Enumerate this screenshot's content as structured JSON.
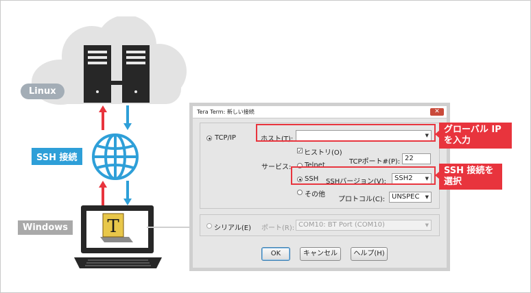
{
  "labels": {
    "linux": "Linux",
    "ssh_connection": "SSH 接続",
    "windows": "Windows",
    "callout_ip_line1": "グローバル IP",
    "callout_ip_line2": "を入力",
    "callout_ssh_line1": "SSH 接続を",
    "callout_ssh_line2": "選択"
  },
  "dialog": {
    "title": "Tera Term: 新しい接続",
    "close": "✕",
    "tcpip": "TCP/IP",
    "host_label": "ホスト(T):",
    "host_value": "",
    "history": "ヒストリ(O)",
    "service_label": "サービス:",
    "telnet": "Telnet",
    "tcp_port_label": "TCPポート#(P):",
    "tcp_port_value": "22",
    "ssh": "SSH",
    "ssh_version_label": "SSHバージョン(V):",
    "ssh_version_value": "SSH2",
    "other": "その他",
    "protocol_label": "プロトコル(C):",
    "protocol_value": "UNSPEC",
    "serial": "シリアル(E)",
    "port_label": "ポート(R):",
    "port_value": "COM10: BT Port (COM10)",
    "ok": "OK",
    "cancel": "キャンセル",
    "help": "ヘルプ(H)"
  },
  "colors": {
    "accent_red": "#e8343d",
    "accent_blue": "#2e9fd8",
    "tag_gray": "#a9a9a9",
    "cloud": "#e3e3e3"
  },
  "icons": [
    "cloud-icon",
    "server-icon",
    "globe-icon",
    "laptop-icon",
    "teraterm-logo-icon",
    "arrow-up-icon",
    "arrow-down-icon"
  ]
}
